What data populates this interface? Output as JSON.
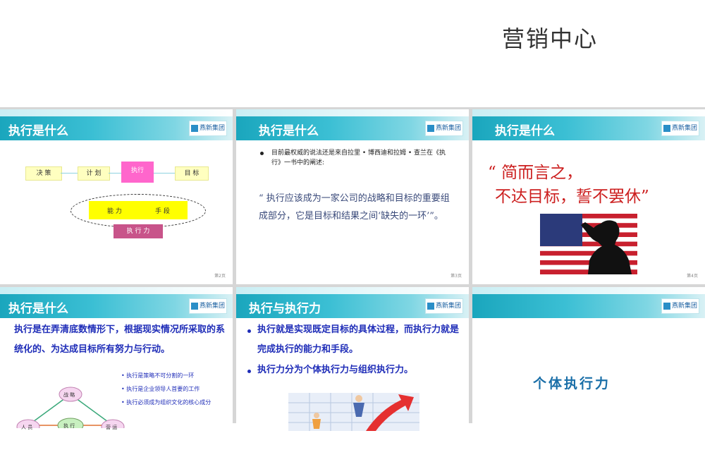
{
  "page_title": "营销中心",
  "slides": [
    {
      "title": "执行是什么",
      "logo": "燕新集团",
      "page": "第2页",
      "diagram": {
        "decision": "决 策",
        "plan": "计 划",
        "execute": "执行",
        "goal": "目 标",
        "ability": "能 力",
        "means": "手 段",
        "exec_power": "执 行 力"
      }
    },
    {
      "title": "执行是什么",
      "logo": "燕新集团",
      "page": "第3页",
      "bullet": "目前最权威的说法还是来自拉里 • 博西迪和拉姆 • 查兰在《执行》一书中的阐述:",
      "quote": "“ 执行应该成为一家公司的战略和目标的重要组成部分，它是目标和结果之间‘缺失的一环’”。"
    },
    {
      "title": "执行是什么",
      "logo": "燕新集团",
      "page": "第4页",
      "quote_line1": "“ 简而言之，",
      "quote_line2": "不达目标，誓不罢休”"
    },
    {
      "title": "执行是什么",
      "logo": "燕新集团",
      "text": "执行是在弄清底数情形下，根据现实情况所采取的系统化的、为达成目标所有努力与行动。",
      "bullets": [
        "执行是策略不可分割的一环",
        "执行是企业领导人首要的工作",
        "执行必须成为组织文化的核心成分"
      ],
      "diagram": {
        "strategy": "战 略",
        "execute": "执 行",
        "left": "人 员",
        "right": "营 运"
      }
    },
    {
      "title": "执行与执行力",
      "logo": "燕新集团",
      "bullets": [
        "执行就是实现既定目标的具体过程，而执行力就是完成执行的能力和手段。",
        "执行力分为个体执行力与组织执行力。"
      ]
    },
    {
      "title": "",
      "logo": "燕新集团",
      "label": "个体执行力"
    }
  ]
}
